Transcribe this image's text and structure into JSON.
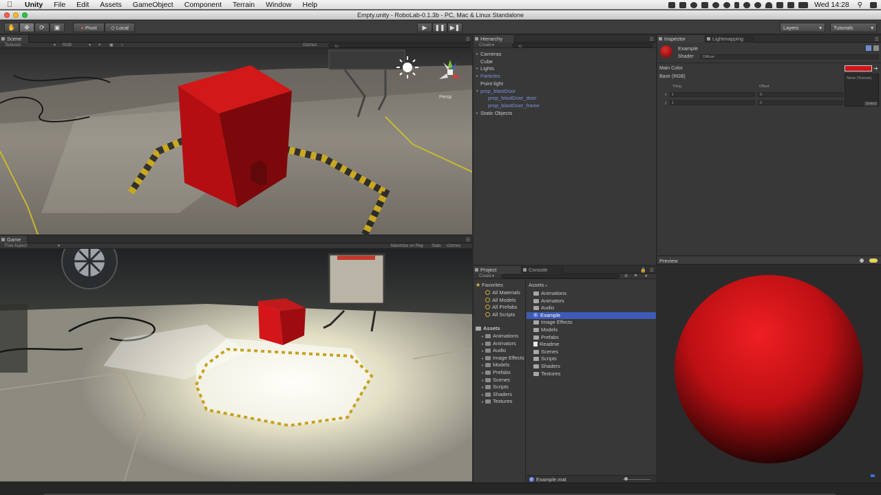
{
  "menubar": {
    "app": "Unity",
    "items": [
      "File",
      "Edit",
      "Assets",
      "GameObject",
      "Component",
      "Terrain",
      "Window",
      "Help"
    ],
    "clock": "Wed 14:28"
  },
  "window": {
    "title": "Empty.unity - RoboLab-0.1.3b - PC, Mac & Linux Standalone"
  },
  "toolbar": {
    "pivot": "Pivot",
    "local": "Local",
    "layers": "Layers",
    "tutorials": "Tutorials"
  },
  "scene": {
    "tab": "Scene",
    "render_mode": "Textured",
    "color_mode": "RGB",
    "gizmos": "Gizmos",
    "search_placeholder": "All",
    "persp": "Persp"
  },
  "game": {
    "tab": "Game",
    "aspect": "Free Aspect",
    "maximize": "Maximize on Play",
    "stats": "Stats",
    "gizmos": "Gizmos"
  },
  "hierarchy": {
    "tab": "Hierarchy",
    "create": "Create",
    "search_placeholder": "All",
    "items": [
      {
        "label": "Cameras",
        "arrow": true,
        "prefab": false,
        "indent": 0
      },
      {
        "label": "Cube",
        "arrow": false,
        "prefab": false,
        "indent": 0
      },
      {
        "label": "Lights",
        "arrow": true,
        "prefab": false,
        "indent": 0
      },
      {
        "label": "Particles",
        "arrow": true,
        "prefab": true,
        "indent": 0
      },
      {
        "label": "Point light",
        "arrow": false,
        "prefab": false,
        "indent": 0
      },
      {
        "label": "prop_blastDoor",
        "arrow": true,
        "prefab": true,
        "indent": 0
      },
      {
        "label": "prop_blastDoor_door",
        "arrow": false,
        "prefab": true,
        "indent": 1
      },
      {
        "label": "prop_blastDoor_frame",
        "arrow": false,
        "prefab": true,
        "indent": 1
      },
      {
        "label": "Static Objects",
        "arrow": true,
        "prefab": false,
        "indent": 0
      }
    ]
  },
  "inspector": {
    "tab": "Inspector",
    "tab2": "Lightmapping",
    "material_name": "Example",
    "shader_label": "Shader",
    "shader_value": "Diffuse",
    "main_color": "Main Color",
    "base": "Base (RGB)",
    "tiling": "Tiling",
    "offset": "Offset",
    "x": "x",
    "y": "y",
    "tiling_x": "1",
    "tiling_y": "1",
    "offset_x": "0",
    "offset_y": "0",
    "texture_none": "None (Texture)",
    "select": "Select",
    "color": "#d0141a"
  },
  "preview": {
    "label": "Preview"
  },
  "project": {
    "tab": "Project",
    "tab2": "Console",
    "create": "Create",
    "favorites_label": "Favorites",
    "favorites": [
      "All Materials",
      "All Models",
      "All Prefabs",
      "All Scripts"
    ],
    "assets_label": "Assets",
    "tree_folders": [
      "Animations",
      "Animators",
      "Audio",
      "Image Effects",
      "Models",
      "Prefabs",
      "Scenes",
      "Scripts",
      "Shaders",
      "Textures"
    ],
    "breadcrumb": "Assets",
    "content": [
      {
        "label": "Animations",
        "type": "folder"
      },
      {
        "label": "Animators",
        "type": "folder"
      },
      {
        "label": "Audio",
        "type": "folder"
      },
      {
        "label": "Example",
        "type": "material",
        "selected": true
      },
      {
        "label": "Image Effects",
        "type": "folder"
      },
      {
        "label": "Models",
        "type": "folder"
      },
      {
        "label": "Prefabs",
        "type": "folder"
      },
      {
        "label": "Readme",
        "type": "file"
      },
      {
        "label": "Scenes",
        "type": "folder"
      },
      {
        "label": "Scripts",
        "type": "folder"
      },
      {
        "label": "Shaders",
        "type": "folder"
      },
      {
        "label": "Textures",
        "type": "folder"
      }
    ],
    "selected_file": "Example.mat"
  }
}
